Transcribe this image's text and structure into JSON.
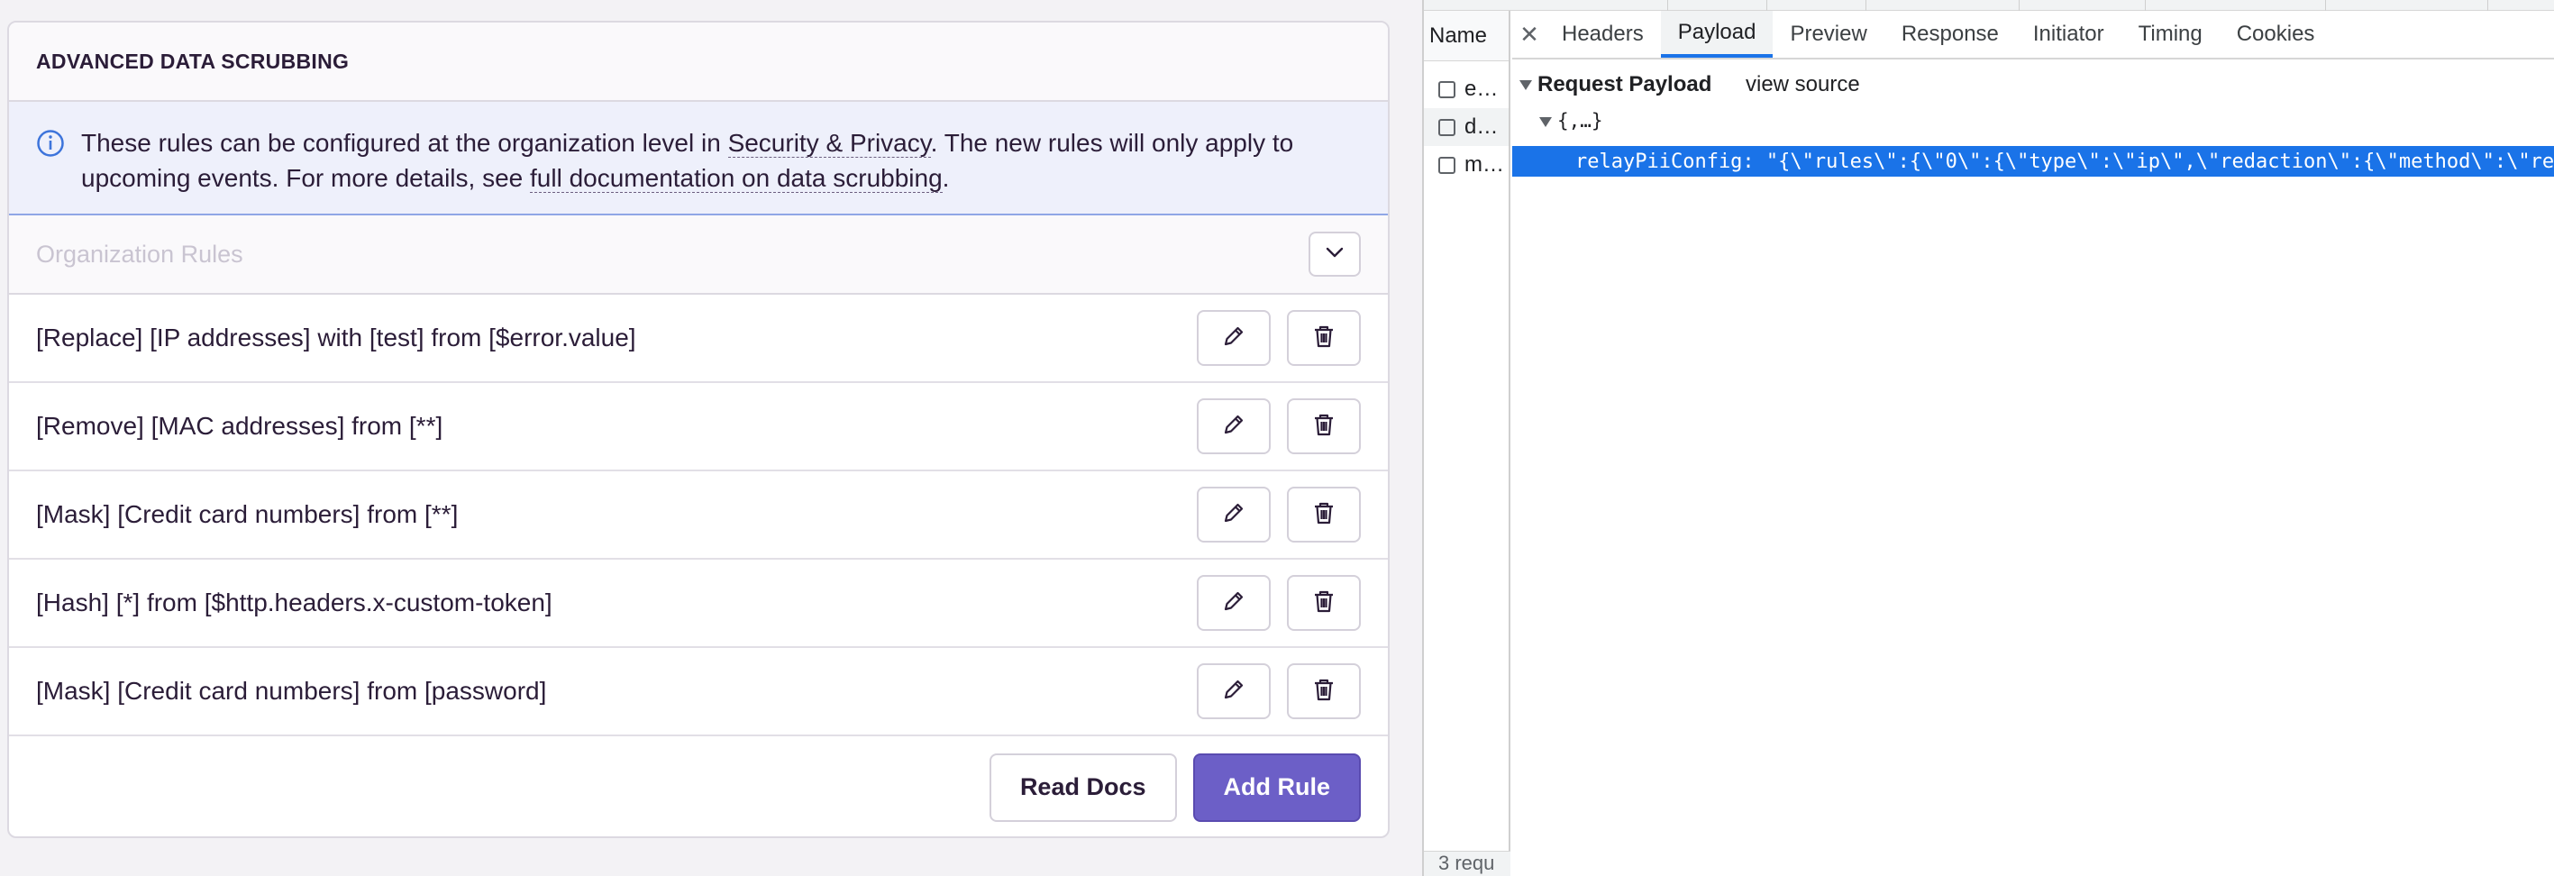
{
  "panel": {
    "title": "ADVANCED DATA SCRUBBING",
    "alert": {
      "text_before": "These rules can be configured at the organization level in ",
      "link1": "Security & Privacy",
      "text_middle": ". The new rules will only apply to upcoming events. For more details, see ",
      "link2": "full documentation on data scrubbing",
      "text_after": "."
    },
    "org_rules_title": "Organization Rules",
    "rules": [
      "[Replace] [IP addresses] with [test] from [$error.value]",
      "[Remove] [MAC addresses] from [**]",
      "[Mask] [Credit card numbers] from [**]",
      "[Hash] [*] from [$http.headers.x-custom-token]",
      "[Mask] [Credit card numbers] from [password]"
    ],
    "buttons": {
      "read_docs": "Read Docs",
      "add_rule": "Add Rule"
    }
  },
  "devtools": {
    "name_header": "Name",
    "requests": [
      "e…",
      "d…",
      "m…"
    ],
    "footer_text": "3 requ",
    "tabs": [
      "Headers",
      "Payload",
      "Preview",
      "Response",
      "Initiator",
      "Timing",
      "Cookies"
    ],
    "active_tab": "Payload",
    "payload": {
      "section_title": "Request Payload",
      "view_source": "view source",
      "object_summary": "{,…}",
      "selected_line": "relayPiiConfig: \"{\\\"rules\\\":{\\\"0\\\":{\\\"type\\\":\\\"ip\\\",\\\"redaction\\\":{\\\"method\\\":\\\"re"
    }
  },
  "colors": {
    "accent": "#6c5fc7",
    "devtools_blue": "#1a73e8",
    "info_blue": "#3d74db"
  }
}
